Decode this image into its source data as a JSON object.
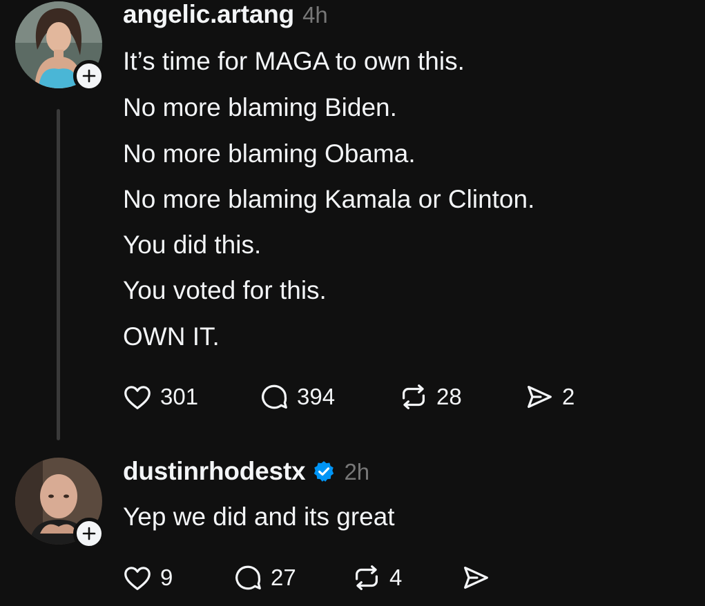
{
  "posts": [
    {
      "username": "angelic.artang",
      "time": "4h",
      "verified": false,
      "lines": [
        "It’s time for MAGA to own this.",
        "No more blaming Biden.",
        "No more blaming Obama.",
        "No more blaming Kamala or Clinton.",
        "You did this.",
        "You voted for this.",
        "OWN IT."
      ],
      "stats": {
        "likes": "301",
        "replies": "394",
        "reposts": "28",
        "shares": "2"
      }
    },
    {
      "username": "dustinrhodestx",
      "time": "2h",
      "verified": true,
      "lines": [
        "Yep we did and its great"
      ],
      "stats": {
        "likes": "9",
        "replies": "27",
        "reposts": "4",
        "shares": ""
      }
    }
  ],
  "colors": {
    "background": "#101010",
    "text": "#f3f5f7",
    "muted": "#777777",
    "verified": "#0095f6",
    "thread_line": "#3a3a3a"
  },
  "icons": [
    "heart-icon",
    "comment-icon",
    "repost-icon",
    "share-icon",
    "plus-icon",
    "verified-badge-icon"
  ]
}
